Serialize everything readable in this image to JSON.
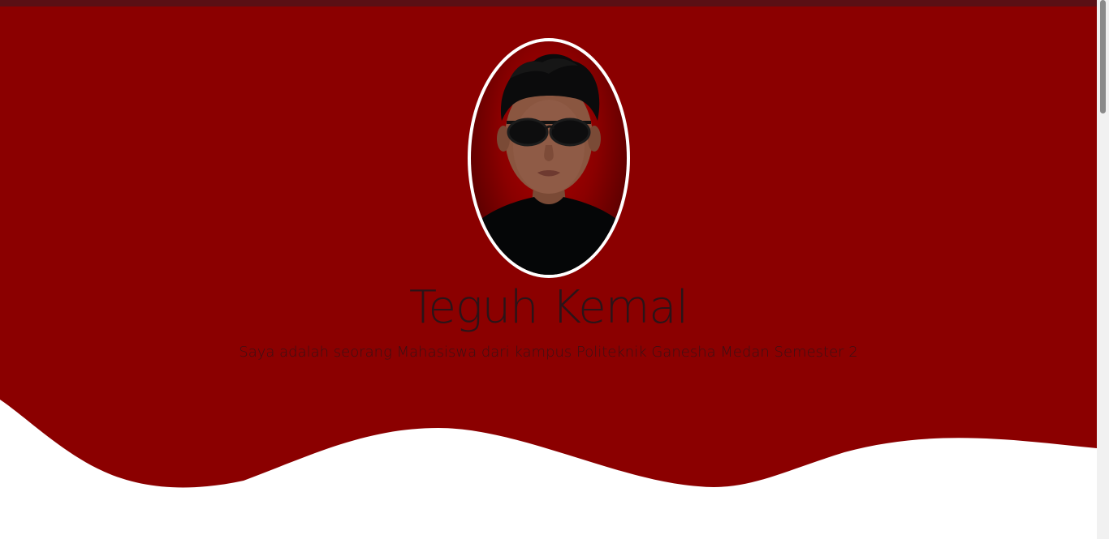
{
  "profile": {
    "name": "Teguh Kemal",
    "bio": "Saya adalah seorang Mahasiswa dari kampus Politeknik Ganesha Medan Semester 2",
    "photo_alt": "Profile photo of a young man wearing black sunglasses and a black t-shirt"
  },
  "colors": {
    "hero_background": "#8b0000",
    "topbar": "#5a0f14",
    "page_background": "#ffffff",
    "avatar_border": "#ffffff",
    "name_text": "#2a1418"
  }
}
